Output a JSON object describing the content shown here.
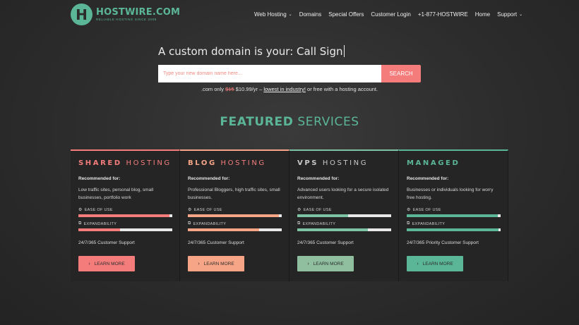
{
  "brand": {
    "logo_letter": "H",
    "name": "HOSTWIRE.COM",
    "tagline": "RELIABLE HOSTING SINCE 2009",
    "accent": "#5bb697",
    "coral": "#f47d7c"
  },
  "nav": {
    "items": [
      {
        "label": "Web Hosting",
        "dropdown": true
      },
      {
        "label": "Domains",
        "dropdown": false
      },
      {
        "label": "Special Offers",
        "dropdown": false
      },
      {
        "label": "Customer Login",
        "dropdown": false
      },
      {
        "label": "+1-877-HOSTWIRE",
        "dropdown": false
      },
      {
        "label": "Home",
        "dropdown": false
      },
      {
        "label": "Support",
        "dropdown": true
      }
    ]
  },
  "hero": {
    "headline": "A custom domain is your: Call Sign",
    "search_placeholder": "Type your new domain name here...",
    "search_value": "",
    "search_button": "SEARCH",
    "price_prefix": ".com only ",
    "price_old": "$15",
    "price_new": " $10.99/yr – ",
    "price_link": "lowest in industry!",
    "price_suffix": " or free with a hosting account."
  },
  "featured": {
    "title_bold": "FEATURED",
    "title_rest": " SERVICES"
  },
  "cards": [
    {
      "title_bold": "SHARED",
      "title_rest": " HOSTING",
      "title_color_bold": "#f47d7c",
      "title_color_rest": "#f47d7c",
      "recommended_label": "Recommended for:",
      "recommended_text": "Low traffic sites, personal blog, small businesses, portfolio work",
      "ease_label": "EASE OF USE",
      "ease_value": 0.97,
      "expand_label": "EXPANDABILITY",
      "expand_value": 0.44,
      "support": "24/7/365 Customer Support",
      "button": "LEARN MORE",
      "bar_color": "#f47d7c",
      "button_color": "#f47d7c"
    },
    {
      "title_bold": "BLOG",
      "title_rest": " HOSTING",
      "title_color_bold": "#f7a587",
      "title_color_rest": "#f47d7c",
      "recommended_label": "Recommended for:",
      "recommended_text": "Professional Bloggers, high traffic sites, small businesses.",
      "ease_label": "EASE OF USE",
      "ease_value": 0.97,
      "expand_label": "EXPANDABILITY",
      "expand_value": 0.76,
      "support": "24/7/365 Customer Support",
      "button": "LEARN MORE",
      "bar_color": "#f7a587",
      "button_color": "#f7a587"
    },
    {
      "title_bold": "VPS",
      "title_rest": " HOSTING",
      "title_color_bold": "#c8c8c8",
      "title_color_rest": "#c8c8c8",
      "recommended_label": "Recommended for:",
      "recommended_text": "Advanced users looking for a secure isolated environment.",
      "ease_label": "EASE OF USE",
      "ease_value": 0.54,
      "expand_label": "EXPANDABILITY",
      "expand_value": 0.75,
      "support": "24/7/365 Customer Support",
      "button": "LEARN MORE",
      "bar_color": "#7dc3a6",
      "button_color": "#8fbf9f"
    },
    {
      "title_bold": "MANAGED",
      "title_rest": "",
      "title_color_bold": "#5bb697",
      "title_color_rest": "#5bb697",
      "recommended_label": "Recommended for:",
      "recommended_text": "Businesses or individuals looking for worry free hosting.",
      "ease_label": "EASE OF USE",
      "ease_value": 0.97,
      "expand_label": "EXPANDABILITY",
      "expand_value": 0.98,
      "support": "24/7/365 Priority Customer Support",
      "button": "LEARN MORE",
      "bar_color": "#5bb697",
      "button_color": "#5bb697"
    }
  ]
}
